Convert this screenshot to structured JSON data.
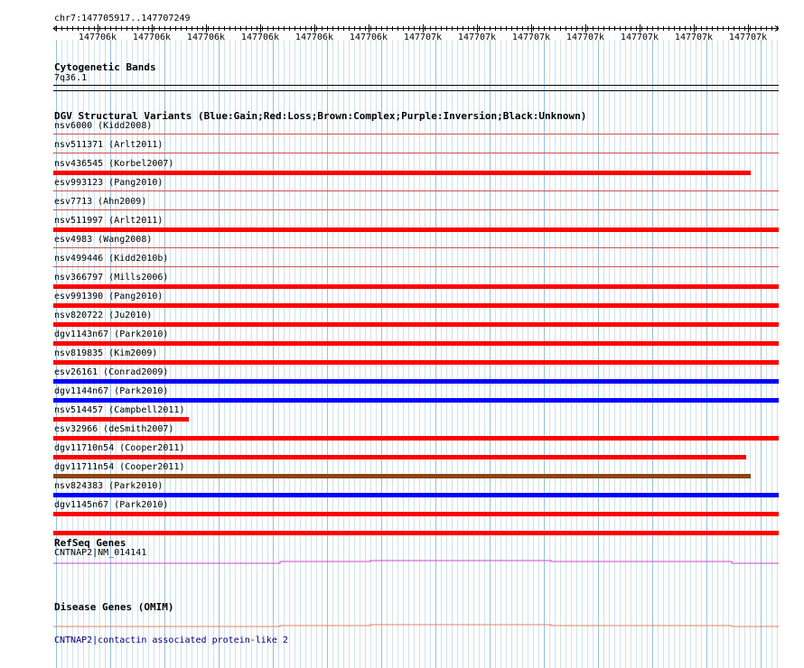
{
  "ruler": {
    "coordinate": "chr7:147705917..147707249",
    "ticks": [
      "147706k",
      "147706k",
      "147706k",
      "147706k",
      "147706k",
      "147706k",
      "147707k",
      "147707k",
      "147707k",
      "147707k",
      "147707k",
      "147707k",
      "147707k"
    ]
  },
  "cytogenetic": {
    "title": "Cytogenetic Bands",
    "band": "7q36.1"
  },
  "dgv": {
    "title": "DGV Structural Variants (Blue:Gain;Red:Loss;Brown:Complex;Purple:Inversion;Black:Unknown)",
    "colors": {
      "gain": "#0000ff",
      "loss": "#ff0000",
      "complex": "#8b4513",
      "separator": "#d05050"
    },
    "variants": [
      {
        "label": "nsv6000 (Kidd2008)",
        "type": "none"
      },
      {
        "label": "nsv511371 (Arlt2011)",
        "type": "loss",
        "start": 0,
        "end": 0.962
      },
      {
        "label": "nsv436545 (Korbel2007)",
        "type": "none"
      },
      {
        "label": "esv993123 (Pang2010)",
        "type": "none"
      },
      {
        "label": "esv7713 (Ahn2009)",
        "type": "loss",
        "start": 0,
        "end": 1
      },
      {
        "label": "nsv511997 (Arlt2011)",
        "type": "none"
      },
      {
        "label": "esv4983 (Wang2008)",
        "type": "none"
      },
      {
        "label": "nsv499446 (Kidd2010b)",
        "type": "loss",
        "start": 0,
        "end": 1
      },
      {
        "label": "nsv366797 (Mills2006)",
        "type": "loss",
        "start": 0,
        "end": 1
      },
      {
        "label": "esv991390 (Pang2010)",
        "type": "loss",
        "start": 0,
        "end": 1
      },
      {
        "label": "nsv820722 (Ju2010)",
        "type": "loss",
        "start": 0,
        "end": 1
      },
      {
        "label": "dgv1143n67 (Park2010)",
        "type": "loss",
        "start": 0,
        "end": 1
      },
      {
        "label": "nsv819835 (Kim2009)",
        "type": "gain",
        "start": 0,
        "end": 1
      },
      {
        "label": "esv26161 (Conrad2009)",
        "type": "gain",
        "start": 0,
        "end": 1
      },
      {
        "label": "dgv1144n67 (Park2010)",
        "type": "loss",
        "start": 0,
        "end": 0.187
      },
      {
        "label": "nsv514457 (Campbell2011)",
        "type": "loss",
        "start": 0,
        "end": 1
      },
      {
        "label": "esv32966 (deSmith2007)",
        "type": "loss",
        "start": 0,
        "end": 0.955
      },
      {
        "label": "dgv11710n54 (Cooper2011)",
        "type": "complex",
        "start": 0,
        "end": 0.962
      },
      {
        "label": "dgv11711n54 (Cooper2011)",
        "type": "gain",
        "start": 0,
        "end": 1
      },
      {
        "label": "nsv824383 (Park2010)",
        "type": "loss",
        "start": 0,
        "end": 1
      },
      {
        "label": "dgv1145n67 (Park2010)",
        "type": "loss",
        "start": 0,
        "end": 1
      }
    ]
  },
  "refseq": {
    "title": "RefSeq Genes",
    "gene": "CNTNAP2|NM_014141",
    "color": "#cc44cc"
  },
  "omim": {
    "title": "Disease Genes (OMIM)",
    "gene": "CNTNAP2|contactin associated protein-like 2",
    "line_color": "#e08060",
    "link_color": "#000080"
  }
}
